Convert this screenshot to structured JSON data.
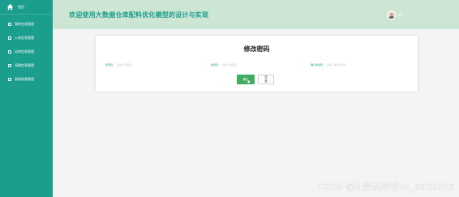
{
  "sidebar": {
    "home_label": "首页",
    "items": [
      {
        "label": "我的信息管理"
      },
      {
        "label": "入库信息管理"
      },
      {
        "label": "出库信息管理"
      },
      {
        "label": "采购信息管理"
      },
      {
        "label": "采购结果管理"
      }
    ]
  },
  "header": {
    "title": "欢迎使用大数据仓库配料优化模型的设计与实现",
    "user_name": "Ff"
  },
  "form": {
    "title": "修改密码",
    "fields": [
      {
        "label": "原密码:",
        "placeholder": "请输入原密码"
      },
      {
        "label": "新密码:",
        "placeholder": "请输入新密码"
      },
      {
        "label": "确认新密码:",
        "placeholder": "请输入确认新密码"
      }
    ],
    "confirm_label": "确定",
    "reset_label": "重置"
  },
  "watermark": "CSDN @计算机毕设vx_BS30813",
  "colors": {
    "sidebar": "#1c9e8d",
    "header": "#cde6d4",
    "primary_button": "#3fae62"
  }
}
